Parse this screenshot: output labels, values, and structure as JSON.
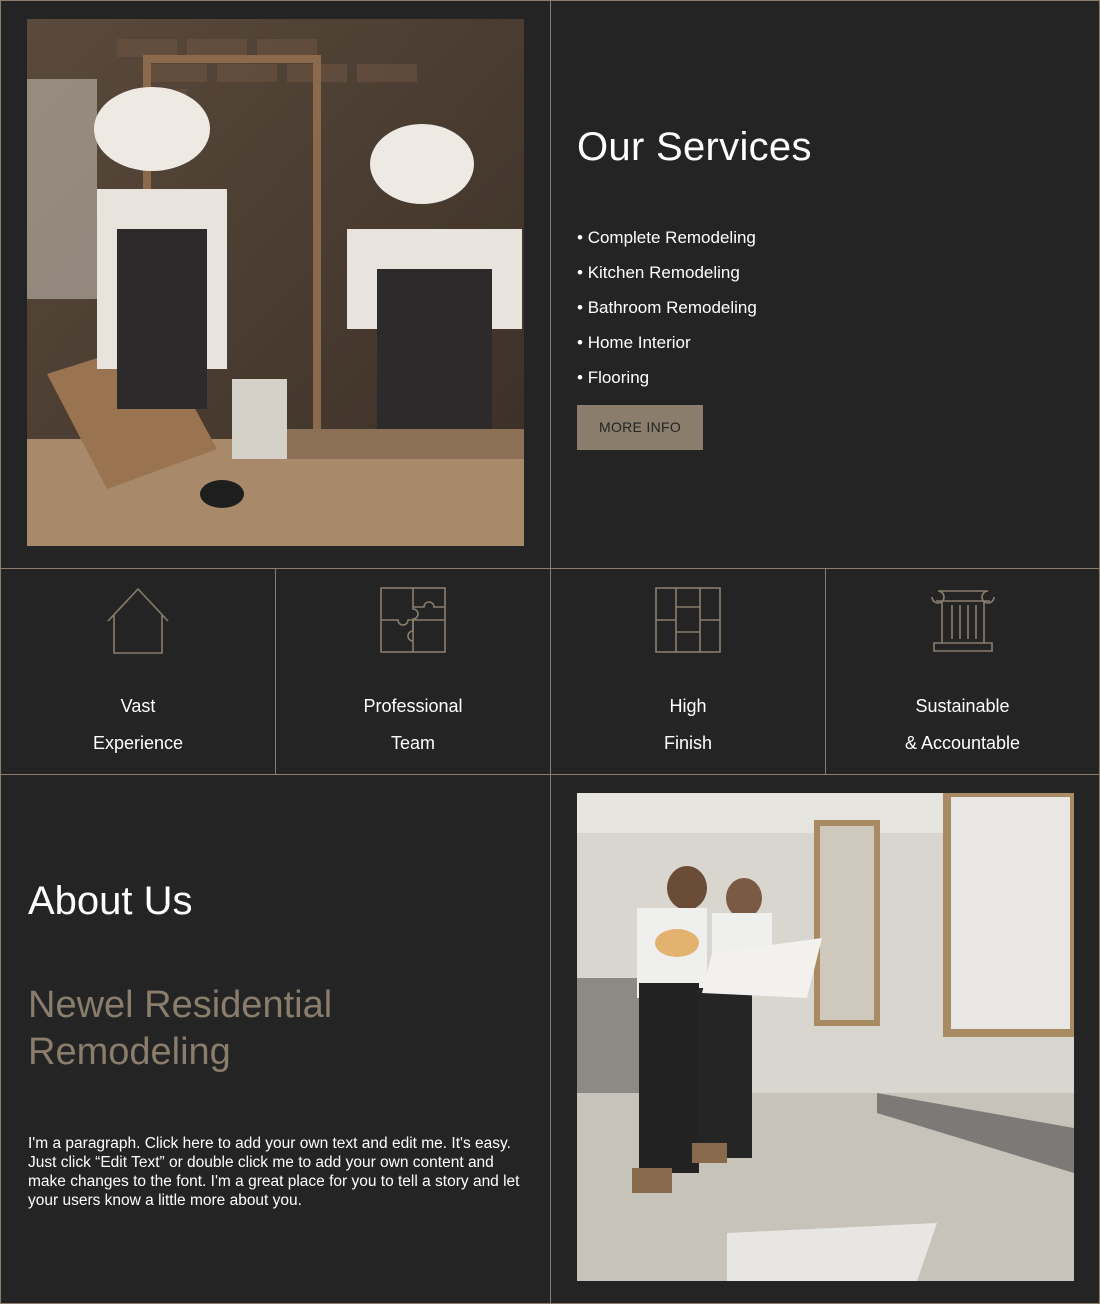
{
  "services": {
    "title": "Our Services",
    "items": [
      "Complete Remodeling",
      "Kitchen Remodeling",
      "Bathroom Remodeling",
      "Home Interior",
      "Flooring"
    ],
    "button_label": "MORE INFO"
  },
  "features": [
    {
      "icon": "house-icon",
      "line1": "Vast",
      "line2": "Experience"
    },
    {
      "icon": "puzzle-icon",
      "line1": "Professional",
      "line2": "Team"
    },
    {
      "icon": "grid-panels-icon",
      "line1": "High",
      "line2": "Finish"
    },
    {
      "icon": "column-icon",
      "line1": "Sustainable",
      "line2": "& Accountable"
    }
  ],
  "about": {
    "title": "About Us",
    "subtitle": "Newel Residential Remodeling",
    "paragraph": "I'm a paragraph. Click here to add your own text and edit me. It's easy. Just click “Edit Text” or double click me to add your own content and make changes to the font. I'm a great place for you to tell a story and let your users know a little more about you."
  },
  "colors": {
    "background": "#242424",
    "accent": "#8a7d6c",
    "text": "#ffffff"
  }
}
